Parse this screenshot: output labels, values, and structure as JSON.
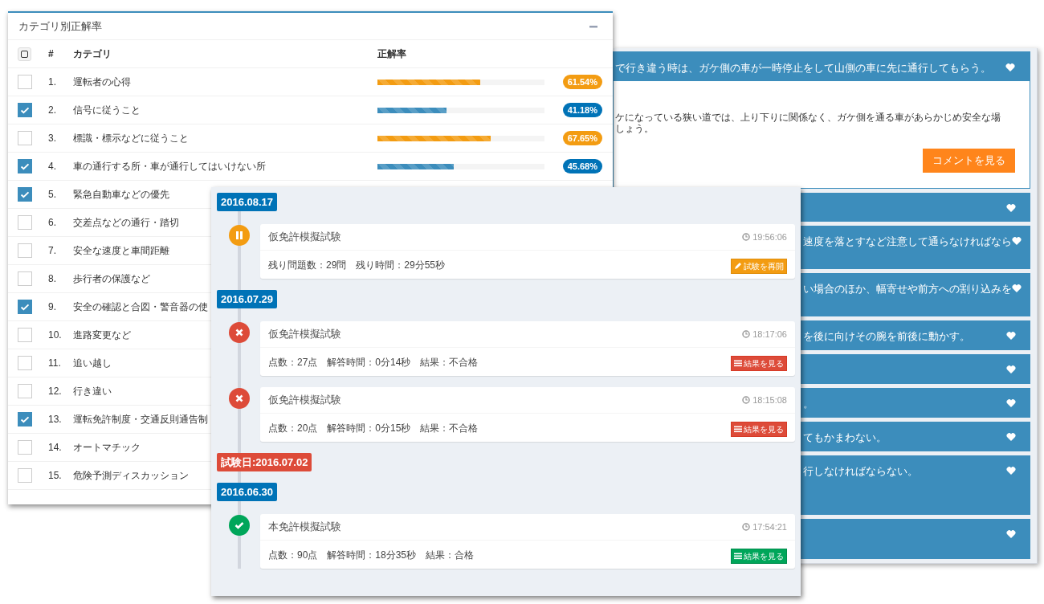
{
  "category_panel": {
    "title": "カテゴリ別正解率",
    "columns": [
      "#",
      "カテゴリ",
      "正解率"
    ],
    "rows": [
      {
        "number": "1.",
        "category": "運転者の心得",
        "checked": false,
        "level": 0.6154,
        "rate": "61.54%",
        "kind": "warning"
      },
      {
        "number": "2.",
        "category": "信号に従うこと",
        "checked": true,
        "level": 0.4118,
        "rate": "41.18%",
        "kind": "primary"
      },
      {
        "number": "3.",
        "category": "標識・標示などに従うこと",
        "checked": false,
        "level": 0.6765,
        "rate": "67.65%",
        "kind": "warning"
      },
      {
        "number": "4.",
        "category": "車の通行する所・車が通行してはいけない所",
        "checked": true,
        "level": 0.4568,
        "rate": "45.68%",
        "kind": "primary"
      },
      {
        "number": "5.",
        "category": "緊急自動車などの優先",
        "checked": true
      },
      {
        "number": "6.",
        "category": "交差点などの通行・踏切",
        "checked": false
      },
      {
        "number": "7.",
        "category": "安全な速度と車間距離",
        "checked": false
      },
      {
        "number": "8.",
        "category": "歩行者の保護など",
        "checked": false
      },
      {
        "number": "9.",
        "category": "安全の確認と合図・警音器の使",
        "checked": true
      },
      {
        "number": "10.",
        "category": "進路変更など",
        "checked": false
      },
      {
        "number": "11.",
        "category": "追い越し",
        "checked": false
      },
      {
        "number": "12.",
        "category": "行き違い",
        "checked": false
      },
      {
        "number": "13.",
        "category": "運転免許制度・交通反則通告制",
        "checked": true
      },
      {
        "number": "14.",
        "category": "オートマチック",
        "checked": false
      },
      {
        "number": "15.",
        "category": "危険予測ディスカッション",
        "checked": false
      }
    ]
  },
  "quiz_panel": {
    "items": [
      {
        "text": "で行き違う時は、ガケ側の車が一時停止をして山側の車に先に通行してもらう。",
        "expanded": true,
        "body": [
          "ケになっている狭い道では、上り下りに関係なく、ガケ側を通る車があらかじめ安全な場",
          "しょう。"
        ],
        "button": "コメントを見る"
      },
      {
        "expanded": false
      },
      {
        "text": "速度を落とすなど注意して通らなければなら",
        "expanded": false
      },
      {
        "text": "い場合のほか、幅寄せや前方への割り込みを",
        "expanded": false
      },
      {
        "text": "を後に向けその腕を前後に動かす。",
        "expanded": false
      },
      {
        "expanded": false
      },
      {
        "text": "。",
        "expanded": false
      },
      {
        "text": "てもかまわない。",
        "expanded": false
      },
      {
        "text": "行しなければならない。",
        "expanded": false
      },
      {
        "expanded": false
      }
    ]
  },
  "timeline": {
    "items": [
      {
        "kind": "date",
        "label": "2016.08.17"
      },
      {
        "kind": "paused",
        "title": "仮免許模擬試験",
        "time": "19:56:06",
        "detail": "残り問題数：29問　残り時間：29分55秒",
        "button": "試験を再開"
      },
      {
        "kind": "date",
        "label": "2016.07.29"
      },
      {
        "kind": "failed",
        "title": "仮免許模擬試験",
        "time": "18:17:06",
        "detail": "点数：27点　解答時間：0分14秒　結果：不合格",
        "button": "結果を見る"
      },
      {
        "kind": "failed",
        "title": "仮免許模擬試験",
        "time": "18:15:08",
        "detail": "点数：20点　解答時間：0分15秒　結果：不合格",
        "button": "結果を見る"
      },
      {
        "kind": "exam_date",
        "label": "試験日:2016.07.02"
      },
      {
        "kind": "date",
        "label": "2016.06.30"
      },
      {
        "kind": "passed",
        "title": "本免許模擬試験",
        "time": "17:54:21",
        "detail": "点数：90点　解答時間：18分35秒　結果：合格",
        "button": "結果を見る"
      }
    ]
  }
}
